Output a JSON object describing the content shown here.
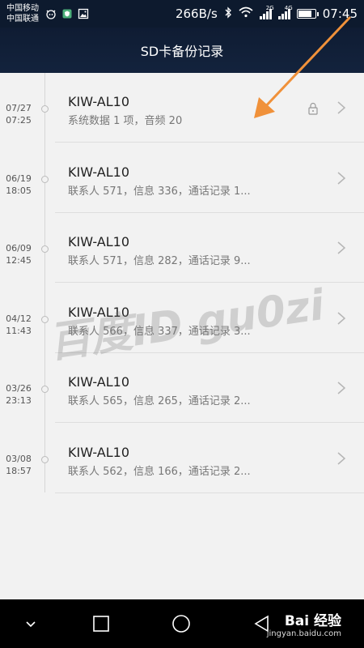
{
  "status_bar": {
    "carrier_1": "中国移动",
    "carrier_2": "中国联通",
    "net_speed": "266B/s",
    "signal_2g": "2G",
    "signal_4g": "4G",
    "time": "07:45",
    "battery_level": 0.85
  },
  "header": {
    "title": "SD卡备份记录"
  },
  "records": [
    {
      "date": "07/27",
      "time": "07:25",
      "device": "KIW-AL10",
      "summary": "系统数据 1 项，音频 20",
      "locked": true
    },
    {
      "date": "06/19",
      "time": "18:05",
      "device": "KIW-AL10",
      "summary": "联系人 571，信息 336，通话记录 1...",
      "locked": false
    },
    {
      "date": "06/09",
      "time": "12:45",
      "device": "KIW-AL10",
      "summary": "联系人 571，信息 282，通话记录 9...",
      "locked": false
    },
    {
      "date": "04/12",
      "time": "11:43",
      "device": "KIW-AL10",
      "summary": "联系人 566，信息 337，通话记录 3...",
      "locked": false
    },
    {
      "date": "03/26",
      "time": "23:13",
      "device": "KIW-AL10",
      "summary": "联系人 565，信息 265，通话记录 2...",
      "locked": false
    },
    {
      "date": "03/08",
      "time": "18:57",
      "device": "KIW-AL10",
      "summary": "联系人 562，信息 166，通话记录 2...",
      "locked": false
    }
  ],
  "watermark": {
    "text": "百度ID gu0zi"
  },
  "nav_bar": {
    "logo": "Bai 经验",
    "site": "jingyan.baidu.com"
  },
  "colors": {
    "status_bg": "#0d1a2e",
    "header_bg": "#13233d",
    "list_bg": "#f2f2f2",
    "annotation_arrow": "#f0913a"
  }
}
